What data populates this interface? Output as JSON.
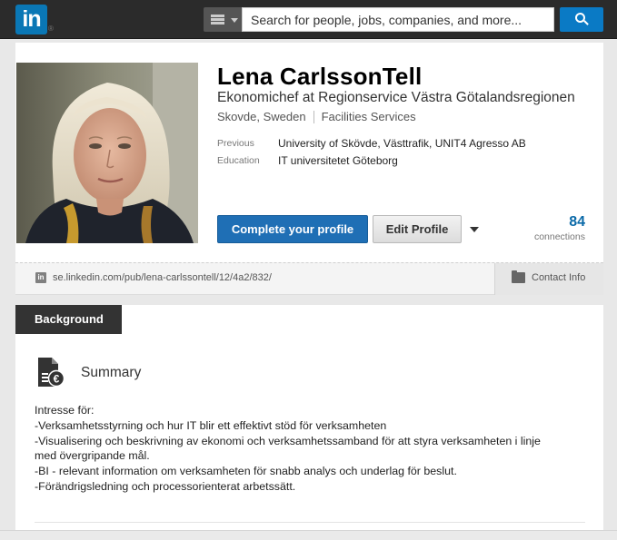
{
  "topbar": {
    "logo_text": "in",
    "logo_reg": "®",
    "search_placeholder": "Search for people, jobs, companies, and more..."
  },
  "profile": {
    "name": "Lena CarlssonTell",
    "headline": "Ekonomichef at Regionservice Västra Götalandsregionen",
    "location": "Skovde, Sweden",
    "industry": "Facilities Services",
    "previous_label": "Previous",
    "previous_value": "University of Skövde, Västtrafik, UNIT4 Agresso AB",
    "education_label": "Education",
    "education_value": "IT universitetet Göteborg",
    "complete_button": "Complete your profile",
    "edit_button": "Edit Profile",
    "connections_count": "84",
    "connections_label": "connections"
  },
  "urlbar": {
    "url": "se.linkedin.com/pub/lena-carlssontell/12/4a2/832/",
    "contact_label": "Contact Info"
  },
  "background": {
    "tab_label": "Background",
    "summary_title": "Summary",
    "summary_lines": [
      "Intresse för:",
      "-Verksamhetsstyrning och hur IT blir ett effektivt stöd för verksamheten",
      "-Visualisering och beskrivning av ekonomi och verksamhetssamband för att styra verksamheten i linje",
      "med övergripande mål.",
      "-BI - relevant information om verksamheten för snabb analys och underlag för beslut.",
      "-Förändrigsledning och processorienterat arbetssätt."
    ]
  },
  "colors": {
    "brand_blue": "#0a77b5",
    "primary_button": "#1f6fb5",
    "connections_blue": "#0b6aa8",
    "topbar": "#2b2b2b"
  },
  "icons": {
    "menu": "menu-icon",
    "search": "search-icon",
    "contact": "contact-card-icon",
    "summary": "summary-document-icon"
  }
}
